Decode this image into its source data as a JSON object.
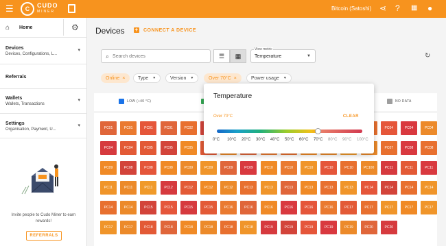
{
  "topbar": {
    "logo_main": "CUDO",
    "logo_sub": "MINER",
    "currency": "Bitcoin (Satoshi)",
    "colors": {
      "brand": "#f7931e"
    }
  },
  "sidebar": {
    "home": "Home",
    "devices": {
      "title": "Devices",
      "subtitle": "Devices, Configurations, L..."
    },
    "referrals": "Referrals",
    "wallets": {
      "title": "Wallets",
      "subtitle": "Wallets, Transactions"
    },
    "settings": {
      "title": "Settings",
      "subtitle": "Organisation, Payment, U..."
    },
    "invite_text": "Invite people to Cudo Miner to earn rewards!",
    "referrals_button": "REFERRALS"
  },
  "main": {
    "title": "Devices",
    "connect_label": "CONNECT A DEVICE",
    "search_placeholder": "Search devices",
    "view_metric_label": "View metric",
    "view_metric_value": "Temperature"
  },
  "filters": {
    "online": "Online",
    "type": "Type",
    "version": "Version",
    "over": "Over 70°C",
    "power": "Power usage"
  },
  "legend": {
    "low": "LOW (+40 °C)",
    "nodata": "NO DATA"
  },
  "popup": {
    "title": "Temperature",
    "subtitle": "Over 70°C",
    "clear": "CLEAR",
    "ticks": [
      "0°C",
      "10°C",
      "20°C",
      "30°C",
      "40°C",
      "50°C",
      "60°C",
      "70°C",
      "80°C",
      "90°C",
      "100°C"
    ]
  },
  "devices": {
    "rows": [
      [
        "PC01",
        "PC01",
        "PC01",
        "PC01",
        "PC02",
        "PC02",
        "PC02",
        "PC03",
        "PC03",
        "PC03",
        "PC03",
        "PC03",
        "PC03",
        "PC04",
        "PC04",
        "PC04",
        "PC04"
      ],
      [
        "PC04",
        "PC04",
        "PC05",
        "PC05",
        "PC05",
        "PC05",
        "PC05",
        "PC05",
        "PC06",
        "PC06",
        "PC06",
        "PC06",
        "PC07",
        "PC07",
        "PC07",
        "PC08",
        "PC08"
      ],
      [
        "PC09",
        "PC08",
        "PC08",
        "PC08",
        "PC09",
        "PC09",
        "PC09",
        "PC09",
        "PC10",
        "PC10",
        "PC10",
        "PC10",
        "PC10",
        "PC100",
        "PC11",
        "PC11",
        "PC11"
      ],
      [
        "PC11",
        "PC11",
        "PC11",
        "PC12",
        "PC12",
        "PC12",
        "PC12",
        "PC13",
        "PC13",
        "PC13",
        "PC13",
        "PC13",
        "PC13",
        "PC14",
        "PC14",
        "PC14",
        "PC14"
      ],
      [
        "PC14",
        "PC14",
        "PC15",
        "PC15",
        "PC15",
        "PC15",
        "PC16",
        "PC16",
        "PC16",
        "PC16",
        "PC16",
        "PC16",
        "PC17",
        "PC17",
        "PC17",
        "PC17",
        "PC17"
      ],
      [
        "PC17",
        "PC17",
        "PC18",
        "PC18",
        "PC18",
        "PC18",
        "PC18",
        "PC18",
        "PC19",
        "PC19",
        "PC19",
        "PC19",
        "PC19",
        "PC20",
        "PC20"
      ]
    ],
    "colors": [
      [
        "#e0663a",
        "#ea7a30",
        "#e5563a",
        "#e0663a",
        "#e8702f",
        "#d3443a",
        "#ea7a30",
        "#f08a26",
        "#e8702f",
        "#ec8a2a",
        "#e8702f",
        "#e35a36",
        "#f0952a",
        "#e8702f",
        "#e5563a",
        "#d9393f",
        "#ec8a2a"
      ],
      [
        "#d63a3e",
        "#e35a36",
        "#e35a36",
        "#d3443a",
        "#f08a26",
        "#e35a36",
        "#ec8a2a",
        "#e0663a",
        "#ea7a30",
        "#e8702f",
        "#f08a26",
        "#ec8a2a",
        "#f09a2a",
        "#ec8a2a",
        "#e8702f",
        "#d9393f",
        "#e8702f"
      ],
      [
        "#f08a26",
        "#d3443a",
        "#e5563a",
        "#f08a26",
        "#ec8a2a",
        "#f0952a",
        "#e0663a",
        "#d9393f",
        "#f08a26",
        "#ea7a30",
        "#f0952a",
        "#e5563a",
        "#e8702f",
        "#ec8a2a",
        "#d63a3e",
        "#e35a36",
        "#d9393f"
      ],
      [
        "#f0952a",
        "#ec8a2a",
        "#f09a2a",
        "#d63a3e",
        "#e35a36",
        "#f08a26",
        "#ec8a2a",
        "#e8702f",
        "#f0952a",
        "#e0663a",
        "#f08a26",
        "#e8702f",
        "#f0952a",
        "#e5563a",
        "#d3443a",
        "#e8702f",
        "#f0952a"
      ],
      [
        "#e8702f",
        "#ec8a2a",
        "#d3443a",
        "#e5563a",
        "#d63a3e",
        "#e35a36",
        "#ea7a30",
        "#e0663a",
        "#f08a26",
        "#d9393f",
        "#e5563a",
        "#ea7a30",
        "#e35a36",
        "#e8702f",
        "#f0952a",
        "#f08a26",
        "#f0952a"
      ],
      [
        "#f0952a",
        "#ec8a2a",
        "#e35a36",
        "#e0663a",
        "#f08a26",
        "#ec8a2a",
        "#e8702f",
        "#f0952a",
        "#d63a3e",
        "#d3443a",
        "#e5563a",
        "#d9393f",
        "#ec8a2a",
        "#e0663a",
        "#d63a3e"
      ]
    ]
  }
}
